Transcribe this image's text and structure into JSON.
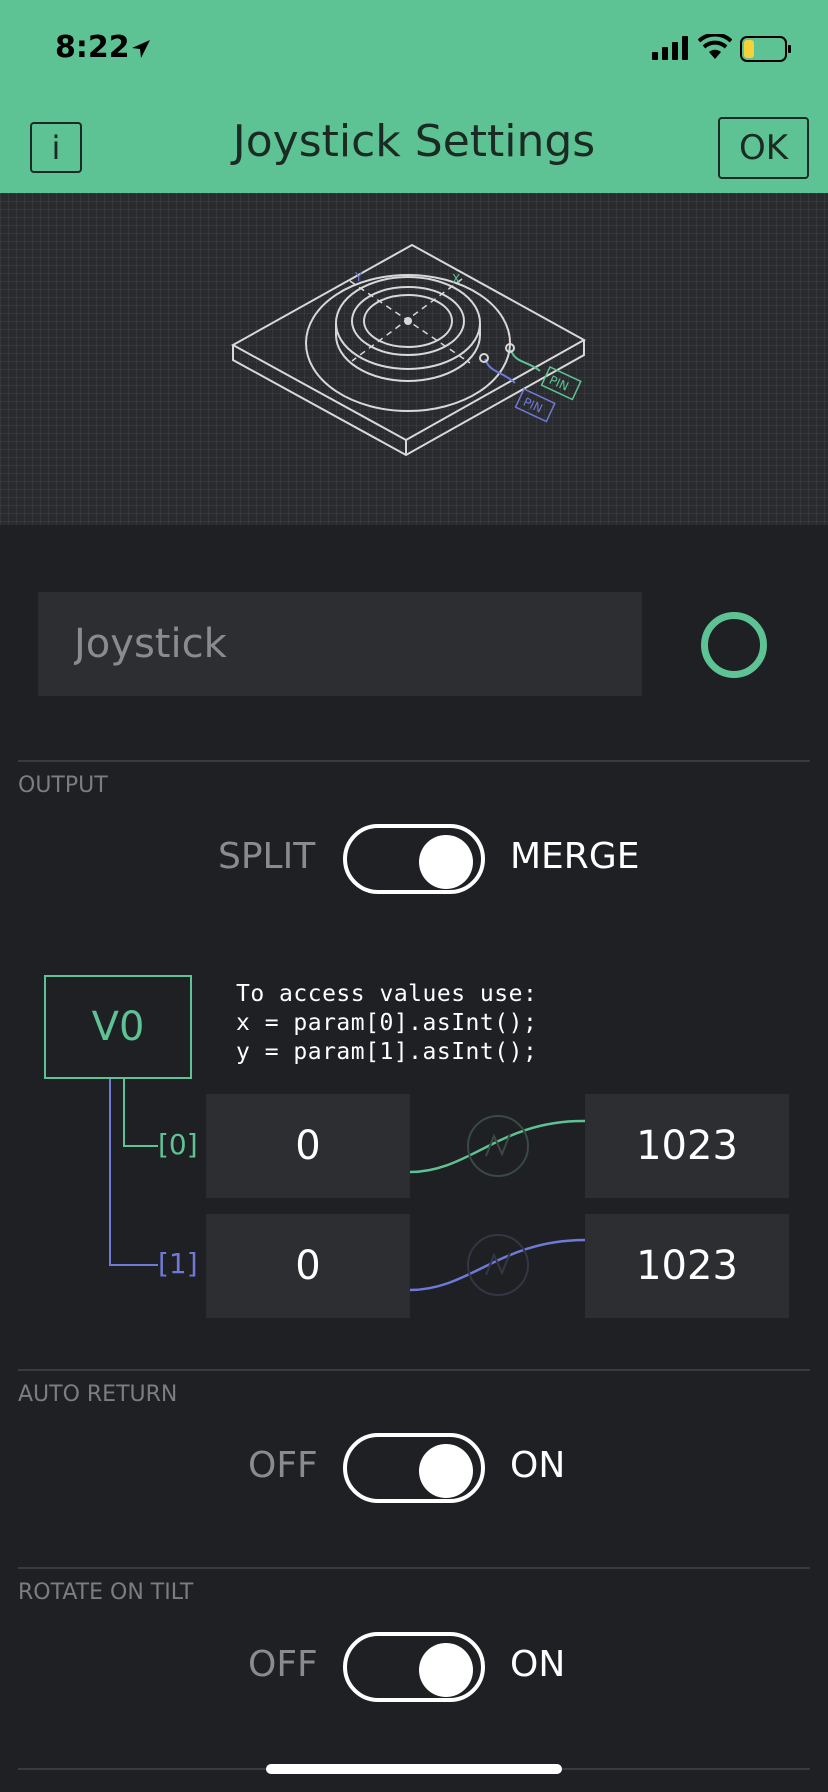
{
  "status_bar": {
    "time": "8:22"
  },
  "header": {
    "info_label": "i",
    "title": "Joystick Settings",
    "ok_label": "OK"
  },
  "illustration": {
    "pin_label_1": "PIN",
    "pin_label_2": "PIN",
    "axis_x": "X",
    "axis_y": "Y"
  },
  "name_field": {
    "value": "Joystick"
  },
  "colors": {
    "accent": "#5ec394",
    "secondary": "#6f79d6",
    "background": "#1f2023"
  },
  "output": {
    "section_label": "OUTPUT",
    "left_label": "SPLIT",
    "right_label": "MERGE",
    "toggle_state": "MERGE",
    "pin": "V0",
    "code_line1": "To access values use:",
    "code_line2": "x = param[0].asInt();",
    "code_line3": "y = param[1].asInt();",
    "rows": [
      {
        "index": "[0]",
        "min": "0",
        "max": "1023"
      },
      {
        "index": "[1]",
        "min": "0",
        "max": "1023"
      }
    ]
  },
  "auto_return": {
    "section_label": "AUTO RETURN",
    "left_label": "OFF",
    "right_label": "ON",
    "toggle_state": "ON"
  },
  "rotate_on_tilt": {
    "section_label": "ROTATE ON TILT",
    "left_label": "OFF",
    "right_label": "ON",
    "toggle_state": "ON"
  }
}
